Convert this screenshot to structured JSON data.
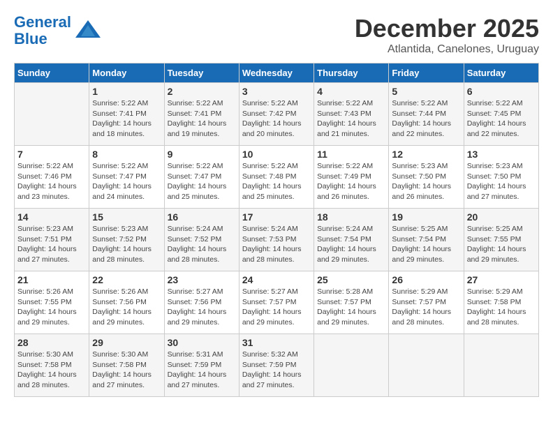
{
  "header": {
    "logo_line1": "General",
    "logo_line2": "Blue",
    "month": "December 2025",
    "location": "Atlantida, Canelones, Uruguay"
  },
  "days_of_week": [
    "Sunday",
    "Monday",
    "Tuesday",
    "Wednesday",
    "Thursday",
    "Friday",
    "Saturday"
  ],
  "weeks": [
    [
      {
        "day": "",
        "info": ""
      },
      {
        "day": "1",
        "info": "Sunrise: 5:22 AM\nSunset: 7:41 PM\nDaylight: 14 hours\nand 18 minutes."
      },
      {
        "day": "2",
        "info": "Sunrise: 5:22 AM\nSunset: 7:41 PM\nDaylight: 14 hours\nand 19 minutes."
      },
      {
        "day": "3",
        "info": "Sunrise: 5:22 AM\nSunset: 7:42 PM\nDaylight: 14 hours\nand 20 minutes."
      },
      {
        "day": "4",
        "info": "Sunrise: 5:22 AM\nSunset: 7:43 PM\nDaylight: 14 hours\nand 21 minutes."
      },
      {
        "day": "5",
        "info": "Sunrise: 5:22 AM\nSunset: 7:44 PM\nDaylight: 14 hours\nand 22 minutes."
      },
      {
        "day": "6",
        "info": "Sunrise: 5:22 AM\nSunset: 7:45 PM\nDaylight: 14 hours\nand 22 minutes."
      }
    ],
    [
      {
        "day": "7",
        "info": "Sunrise: 5:22 AM\nSunset: 7:46 PM\nDaylight: 14 hours\nand 23 minutes."
      },
      {
        "day": "8",
        "info": "Sunrise: 5:22 AM\nSunset: 7:47 PM\nDaylight: 14 hours\nand 24 minutes."
      },
      {
        "day": "9",
        "info": "Sunrise: 5:22 AM\nSunset: 7:47 PM\nDaylight: 14 hours\nand 25 minutes."
      },
      {
        "day": "10",
        "info": "Sunrise: 5:22 AM\nSunset: 7:48 PM\nDaylight: 14 hours\nand 25 minutes."
      },
      {
        "day": "11",
        "info": "Sunrise: 5:22 AM\nSunset: 7:49 PM\nDaylight: 14 hours\nand 26 minutes."
      },
      {
        "day": "12",
        "info": "Sunrise: 5:23 AM\nSunset: 7:50 PM\nDaylight: 14 hours\nand 26 minutes."
      },
      {
        "day": "13",
        "info": "Sunrise: 5:23 AM\nSunset: 7:50 PM\nDaylight: 14 hours\nand 27 minutes."
      }
    ],
    [
      {
        "day": "14",
        "info": "Sunrise: 5:23 AM\nSunset: 7:51 PM\nDaylight: 14 hours\nand 27 minutes."
      },
      {
        "day": "15",
        "info": "Sunrise: 5:23 AM\nSunset: 7:52 PM\nDaylight: 14 hours\nand 28 minutes."
      },
      {
        "day": "16",
        "info": "Sunrise: 5:24 AM\nSunset: 7:52 PM\nDaylight: 14 hours\nand 28 minutes."
      },
      {
        "day": "17",
        "info": "Sunrise: 5:24 AM\nSunset: 7:53 PM\nDaylight: 14 hours\nand 28 minutes."
      },
      {
        "day": "18",
        "info": "Sunrise: 5:24 AM\nSunset: 7:54 PM\nDaylight: 14 hours\nand 29 minutes."
      },
      {
        "day": "19",
        "info": "Sunrise: 5:25 AM\nSunset: 7:54 PM\nDaylight: 14 hours\nand 29 minutes."
      },
      {
        "day": "20",
        "info": "Sunrise: 5:25 AM\nSunset: 7:55 PM\nDaylight: 14 hours\nand 29 minutes."
      }
    ],
    [
      {
        "day": "21",
        "info": "Sunrise: 5:26 AM\nSunset: 7:55 PM\nDaylight: 14 hours\nand 29 minutes."
      },
      {
        "day": "22",
        "info": "Sunrise: 5:26 AM\nSunset: 7:56 PM\nDaylight: 14 hours\nand 29 minutes."
      },
      {
        "day": "23",
        "info": "Sunrise: 5:27 AM\nSunset: 7:56 PM\nDaylight: 14 hours\nand 29 minutes."
      },
      {
        "day": "24",
        "info": "Sunrise: 5:27 AM\nSunset: 7:57 PM\nDaylight: 14 hours\nand 29 minutes."
      },
      {
        "day": "25",
        "info": "Sunrise: 5:28 AM\nSunset: 7:57 PM\nDaylight: 14 hours\nand 29 minutes."
      },
      {
        "day": "26",
        "info": "Sunrise: 5:29 AM\nSunset: 7:57 PM\nDaylight: 14 hours\nand 28 minutes."
      },
      {
        "day": "27",
        "info": "Sunrise: 5:29 AM\nSunset: 7:58 PM\nDaylight: 14 hours\nand 28 minutes."
      }
    ],
    [
      {
        "day": "28",
        "info": "Sunrise: 5:30 AM\nSunset: 7:58 PM\nDaylight: 14 hours\nand 28 minutes."
      },
      {
        "day": "29",
        "info": "Sunrise: 5:30 AM\nSunset: 7:58 PM\nDaylight: 14 hours\nand 27 minutes."
      },
      {
        "day": "30",
        "info": "Sunrise: 5:31 AM\nSunset: 7:59 PM\nDaylight: 14 hours\nand 27 minutes."
      },
      {
        "day": "31",
        "info": "Sunrise: 5:32 AM\nSunset: 7:59 PM\nDaylight: 14 hours\nand 27 minutes."
      },
      {
        "day": "",
        "info": ""
      },
      {
        "day": "",
        "info": ""
      },
      {
        "day": "",
        "info": ""
      }
    ]
  ]
}
